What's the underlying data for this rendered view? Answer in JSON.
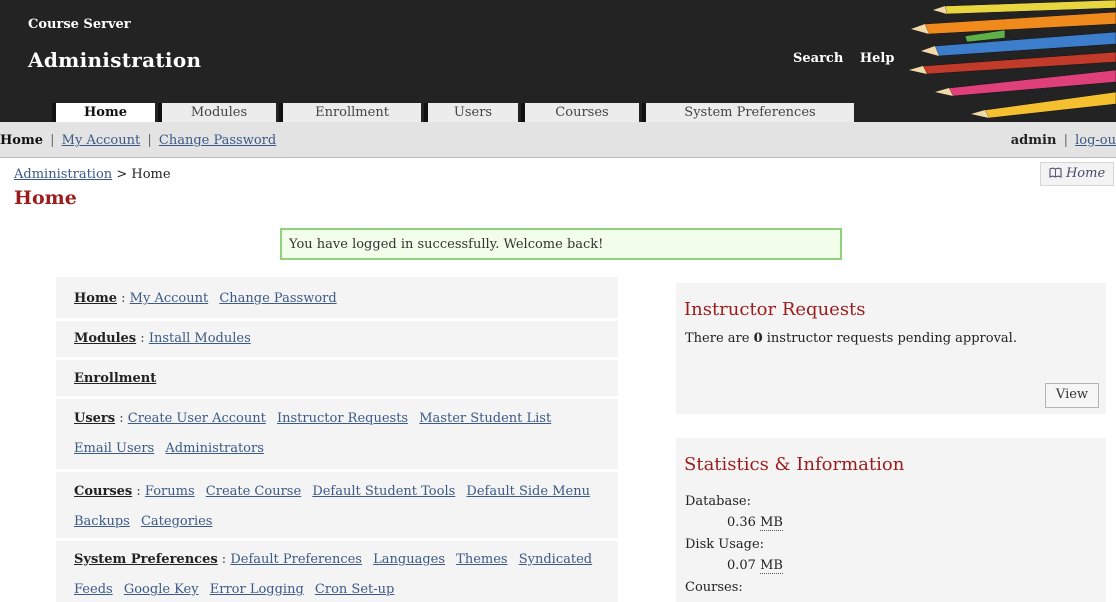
{
  "header": {
    "site_name": "Course Server",
    "section_title": "Administration",
    "search_link": "Search",
    "help_link": "Help"
  },
  "tabs": [
    {
      "label": "Home",
      "active": true
    },
    {
      "label": "Modules",
      "active": false
    },
    {
      "label": "Enrollment",
      "active": false
    },
    {
      "label": "Users",
      "active": false
    },
    {
      "label": "Courses",
      "active": false
    },
    {
      "label": "System Preferences",
      "active": false
    }
  ],
  "subbar": {
    "home": "Home",
    "separator": "|",
    "my_account": "My Account",
    "change_password": "Change Password",
    "user": "admin",
    "logout": "log-ou"
  },
  "breadcrumb": {
    "parent": "Administration",
    "arrow": ">",
    "current": "Home"
  },
  "home_button": {
    "icon": "book-icon",
    "label": "Home"
  },
  "page_title": "Home",
  "feedback": "You have logged in successfully. Welcome back!",
  "menu": {
    "colon": ":",
    "home": {
      "head": "Home",
      "links": [
        "My Account",
        "Change Password"
      ]
    },
    "modules": {
      "head": "Modules",
      "links": [
        "Install Modules"
      ]
    },
    "enrollment": {
      "head": "Enrollment",
      "links": []
    },
    "users": {
      "head": "Users",
      "links": [
        "Create User Account",
        "Instructor Requests",
        "Master Student List",
        "Email Users",
        "Administrators"
      ]
    },
    "courses": {
      "head": "Courses",
      "links": [
        "Forums",
        "Create Course",
        "Default Student Tools",
        "Default Side Menu",
        "Backups",
        "Categories"
      ]
    },
    "system_preferences": {
      "head": "System Preferences",
      "links": [
        "Default Preferences",
        "Languages",
        "Themes",
        "Syndicated Feeds",
        "Google Key",
        "Error Logging",
        "Cron Set-up"
      ]
    }
  },
  "instructor_requests": {
    "title": "Instructor Requests",
    "text_before": "There are",
    "count": "0",
    "text_after": "instructor requests pending approval.",
    "view_button": "View"
  },
  "statistics": {
    "title": "Statistics & Information",
    "database_label": "Database:",
    "database_value": "0.36",
    "disk_usage_label": "Disk Usage:",
    "disk_usage_value": "0.07",
    "unit": "MB",
    "courses_label": "Courses:"
  },
  "colors": {
    "header_bg": "#232323",
    "title_red": "#9b1c1c",
    "link_blue": "#3b5a85",
    "feedback_border": "#8fd17c",
    "feedback_bg": "#f2fdea"
  }
}
